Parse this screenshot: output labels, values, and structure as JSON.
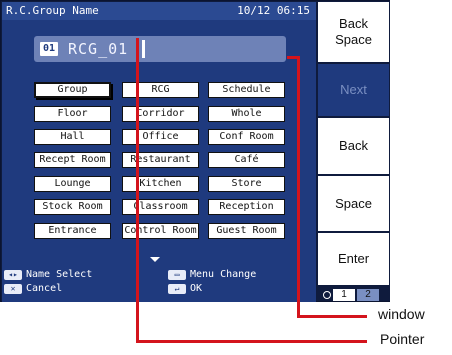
{
  "screen": {
    "title": "R.C.Group Name",
    "datetime": "10/12 06:15",
    "name_index": "01",
    "name_value": "RCG_01"
  },
  "buttons": [
    [
      "Group",
      "RCG",
      "Schedule"
    ],
    [
      "Floor",
      "Corridor",
      "Whole"
    ],
    [
      "Hall",
      "Office",
      "Conf Room"
    ],
    [
      "Recept Room",
      "Restaurant",
      "Café"
    ],
    [
      "Lounge",
      "Kitchen",
      "Store"
    ],
    [
      "Stock Room",
      "Classroom",
      "Reception"
    ],
    [
      "Entrance",
      "Control Room",
      "Guest Room"
    ]
  ],
  "footer": {
    "name_select": "Name Select",
    "cancel": "Cancel",
    "menu_change": "Menu Change",
    "ok": "OK",
    "icon_name_select": "◂▸",
    "icon_cancel": "✕",
    "icon_menu": "▭",
    "icon_ok": "↵"
  },
  "side_panel": {
    "back_space_line1": "Back",
    "back_space_line2": "Space",
    "next": "Next",
    "back": "Back",
    "space": "Space",
    "enter": "Enter",
    "page1": "1",
    "page2": "2"
  },
  "callouts": {
    "window": "window",
    "pointer": "Pointer"
  },
  "colors": {
    "accent_red": "#d4141c",
    "screen_bg": "#1f3a7e",
    "frame": "#0f1b3d"
  }
}
